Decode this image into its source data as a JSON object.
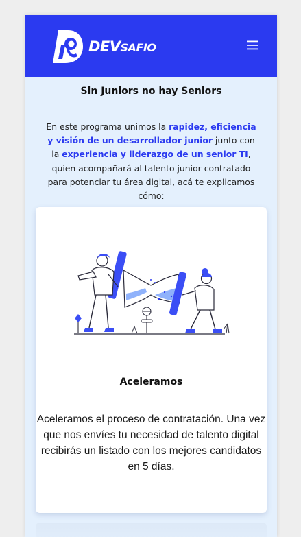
{
  "header": {
    "brand_dev": "DEV",
    "brand_safio": "SAFIO",
    "menu_icon": "hamburger-menu-icon",
    "logo_icon": "devsafio-logo-icon",
    "background_color": "#2b3af0"
  },
  "main": {
    "headline": "Sin Juniors no hay Seniors",
    "intro": {
      "p1": "En este programa unimos la ",
      "h1": "rapidez, eficiencia y visión de un desarrollador junior",
      "p2": " junto con la ",
      "h2": "experiencia y liderazgo de un senior TI",
      "p3": ", quien acompañará al talento junior contratado para potenciar tu área digital, acá te explicamos cómo:"
    },
    "highlight_color": "#2b3af0",
    "background_color": "#e4f0fd"
  },
  "card": {
    "illustration": "two-people-turning-hourglass-illustration",
    "title": "Aceleramos",
    "text": "Aceleramos el proceso de contratación. Una vez que nos envíes tu necesidad de talento digital recibirás un listado con los mejores candidatos en 5 días."
  }
}
